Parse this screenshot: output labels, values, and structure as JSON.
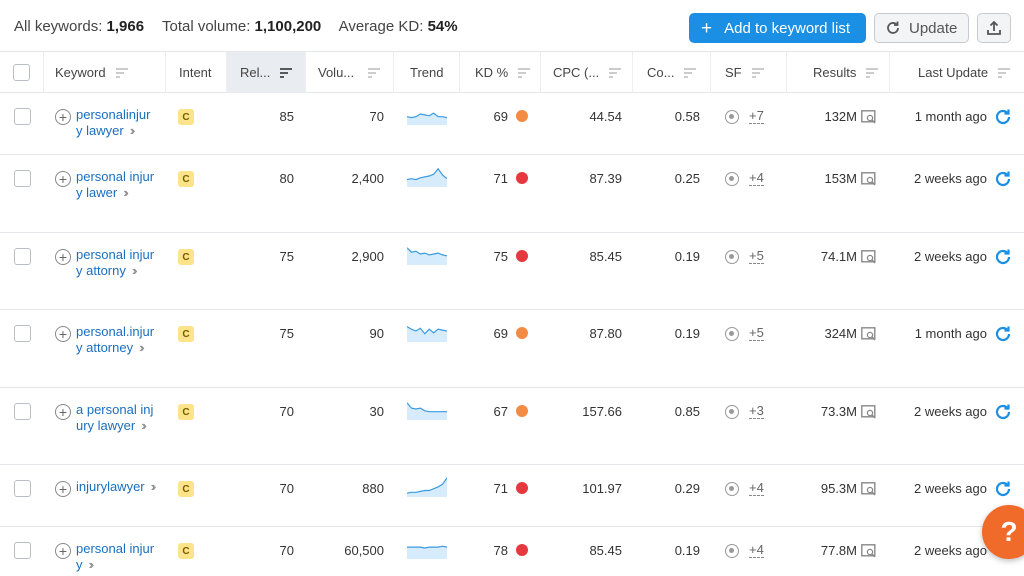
{
  "summary": {
    "all_keywords_label": "All keywords:",
    "all_keywords_value": "1,966",
    "total_volume_label": "Total volume:",
    "total_volume_value": "1,100,200",
    "avg_kd_label": "Average KD:",
    "avg_kd_value": "54%"
  },
  "toolbar": {
    "add_label": "Add to keyword list",
    "update_label": "Update"
  },
  "columns": {
    "keyword": "Keyword",
    "intent": "Intent",
    "relevance": "Rel...",
    "volume": "Volu...",
    "trend": "Trend",
    "kd": "KD %",
    "cpc": "CPC (...",
    "com": "Co...",
    "sf": "SF",
    "results": "Results",
    "last_update": "Last Update"
  },
  "colors": {
    "accent": "#1a8fe3",
    "kd_orange": "#f28c45",
    "kd_red": "#e5393f",
    "intent_badge": "#fde38a",
    "help": "#f06a2a"
  },
  "rows": [
    {
      "keyword": "personalinjury lawyer",
      "intent": "C",
      "rel": "85",
      "volume": "70",
      "kd": "69",
      "kd_color": "#f28c45",
      "cpc": "44.54",
      "com": "0.58",
      "sf": "+7",
      "results": "132M",
      "updated": "1 month ago",
      "trend": [
        0.35,
        0.3,
        0.35,
        0.5,
        0.45,
        0.4,
        0.55,
        0.35,
        0.35,
        0.3
      ]
    },
    {
      "keyword": "personal injury lawer",
      "intent": "C",
      "rel": "80",
      "volume": "2,400",
      "kd": "71",
      "kd_color": "#e5393f",
      "cpc": "87.39",
      "com": "0.25",
      "sf": "+4",
      "results": "153M",
      "updated": "2 weeks ago",
      "trend": [
        0.3,
        0.35,
        0.3,
        0.4,
        0.45,
        0.5,
        0.6,
        0.9,
        0.55,
        0.35
      ]
    },
    {
      "keyword": "personal injury attorny",
      "intent": "C",
      "rel": "75",
      "volume": "2,900",
      "kd": "75",
      "kd_color": "#e5393f",
      "cpc": "85.45",
      "com": "0.19",
      "sf": "+5",
      "results": "74.1M",
      "updated": "2 weeks ago",
      "trend": [
        0.85,
        0.6,
        0.65,
        0.5,
        0.55,
        0.45,
        0.5,
        0.55,
        0.45,
        0.4
      ]
    },
    {
      "keyword": "personal.injury attorney",
      "intent": "C",
      "rel": "75",
      "volume": "90",
      "kd": "69",
      "kd_color": "#f28c45",
      "cpc": "87.80",
      "com": "0.19",
      "sf": "+5",
      "results": "324M",
      "updated": "1 month ago",
      "trend": [
        0.75,
        0.6,
        0.5,
        0.65,
        0.35,
        0.6,
        0.4,
        0.6,
        0.55,
        0.5
      ]
    },
    {
      "keyword": "a personal injury lawyer",
      "intent": "C",
      "rel": "70",
      "volume": "30",
      "kd": "67",
      "kd_color": "#f28c45",
      "cpc": "157.66",
      "com": "0.85",
      "sf": "+3",
      "results": "73.3M",
      "updated": "2 weeks ago",
      "trend": [
        0.85,
        0.55,
        0.5,
        0.55,
        0.4,
        0.35,
        0.35,
        0.35,
        0.35,
        0.35
      ]
    },
    {
      "keyword": "injurylawyer",
      "intent": "C",
      "rel": "70",
      "volume": "880",
      "kd": "71",
      "kd_color": "#e5393f",
      "cpc": "101.97",
      "com": "0.29",
      "sf": "+4",
      "results": "95.3M",
      "updated": "2 weeks ago",
      "trend": [
        0.1,
        0.15,
        0.15,
        0.2,
        0.25,
        0.25,
        0.35,
        0.45,
        0.6,
        0.95
      ]
    },
    {
      "keyword": "personal injury",
      "intent": "C",
      "rel": "70",
      "volume": "60,500",
      "kd": "78",
      "kd_color": "#e5393f",
      "cpc": "85.45",
      "com": "0.19",
      "sf": "+4",
      "results": "77.8M",
      "updated": "2 weeks ago",
      "trend": [
        0.55,
        0.55,
        0.55,
        0.55,
        0.5,
        0.55,
        0.55,
        0.55,
        0.6,
        0.55
      ]
    }
  ],
  "help": {
    "label": "?"
  }
}
